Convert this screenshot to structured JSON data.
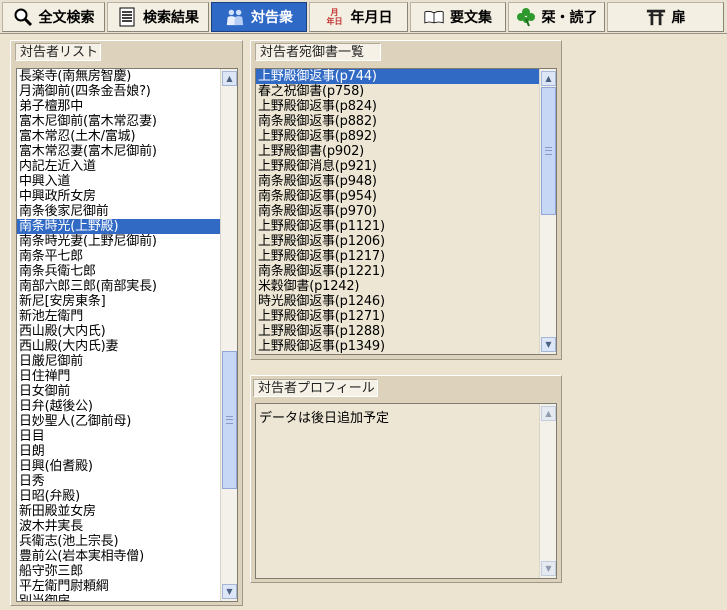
{
  "toolbar": {
    "tabs": [
      {
        "label": "全文検索",
        "icon": "magnifier-icon"
      },
      {
        "label": "検索結果",
        "icon": "document-list-icon"
      },
      {
        "label": "対告衆",
        "icon": "people-icon"
      },
      {
        "label": "年月日",
        "icon": "calendar-icon"
      },
      {
        "label": "要文集",
        "icon": "open-book-icon"
      },
      {
        "label": "栞・読了",
        "icon": "clover-icon"
      },
      {
        "label": "扉",
        "icon": "torii-gate-icon"
      }
    ],
    "active_tab": "対告衆",
    "calendar_glyphs": "月\n年日"
  },
  "person_list": {
    "label": "対告者リスト",
    "selected": "南条時光(上野殿)",
    "items": [
      "長楽寺(南無房智慶)",
      "月満御前(四条金吾娘?)",
      "弟子檀那中",
      "富木尼御前(富木常忍妻)",
      "富木常忍(土木/富城)",
      "富木常忍妻(富木尼御前)",
      "内記左近入道",
      "中興入道",
      "中興政所女房",
      "南条後家尼御前",
      "南条時光(上野殿)",
      "南条時光妻(上野尼御前)",
      "南条平七郎",
      "南条兵衛七郎",
      "南部六郎三郎(南部実長)",
      "新尼[安房東条]",
      "新池左衛門",
      "西山殿(大内氏)",
      "西山殿(大内氏)妻",
      "日厳尼御前",
      "日住禅門",
      "日女御前",
      "日弁(越後公)",
      "日妙聖人(乙御前母)",
      "日目",
      "日朗",
      "日興(伯耆殿)",
      "日秀",
      "日昭(弁殿)",
      "新田殿並女房",
      "波木井実長",
      "兵衛志(池上宗長)",
      "豊前公(岩本実相寺僧)",
      "船守弥三郎",
      "平左衛門尉頼綱",
      "別当御房"
    ]
  },
  "letters_list": {
    "label": "対告者宛御書一覧",
    "selected": "上野殿御返事(p744)",
    "items": [
      "上野殿御返事(p744)",
      "春之祝御書(p758)",
      "上野殿御返事(p824)",
      "南条殿御返事(p882)",
      "上野殿御返事(p892)",
      "上野殿御書(p902)",
      "上野殿御消息(p921)",
      "南条殿御返事(p948)",
      "南条殿御返事(p954)",
      "南条殿御返事(p970)",
      "上野殿御返事(p1121)",
      "上野殿御返事(p1206)",
      "上野殿御返事(p1217)",
      "南条殿御返事(p1221)",
      "米穀御書(p1242)",
      "時光殿御返事(p1246)",
      "上野殿御返事(p1271)",
      "上野殿御返事(p1288)",
      "上野殿御返事(p1349)"
    ]
  },
  "profile": {
    "label": "対告者プロフィール",
    "text": "データは後日追加予定"
  },
  "colors": {
    "selection": "#316ac5",
    "active_tab": "#2f69c6",
    "background": "#ece3d0"
  }
}
